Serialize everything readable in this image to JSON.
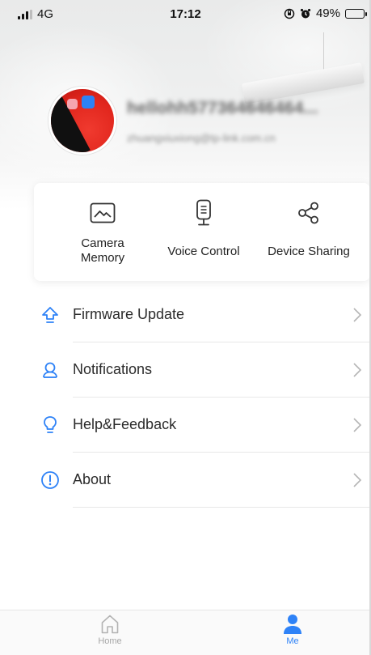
{
  "status_bar": {
    "carrier": "4G",
    "time": "17:12",
    "battery_percent": "49%",
    "battery_level": 0.49
  },
  "profile": {
    "username": "hellohh577364646464...",
    "email": "zhuangxiuxiong@tp-link.com.cn"
  },
  "quick_actions": [
    {
      "label": "Camera\nMemory",
      "icon": "gallery-icon"
    },
    {
      "label": "Voice Control",
      "icon": "speaker-icon"
    },
    {
      "label": "Device Sharing",
      "icon": "share-icon"
    }
  ],
  "menu": [
    {
      "label": "Firmware Update",
      "icon": "firmware-upload-icon"
    },
    {
      "label": "Notifications",
      "icon": "bell-icon"
    },
    {
      "label": "Help&Feedback",
      "icon": "lightbulb-icon"
    },
    {
      "label": "About",
      "icon": "info-icon"
    }
  ],
  "tabbar": {
    "home_label": "Home",
    "me_label": "Me",
    "active": "Me"
  },
  "colors": {
    "accent": "#2e82f7",
    "text": "#2b2b2b",
    "inactive": "#a6a6a6"
  }
}
